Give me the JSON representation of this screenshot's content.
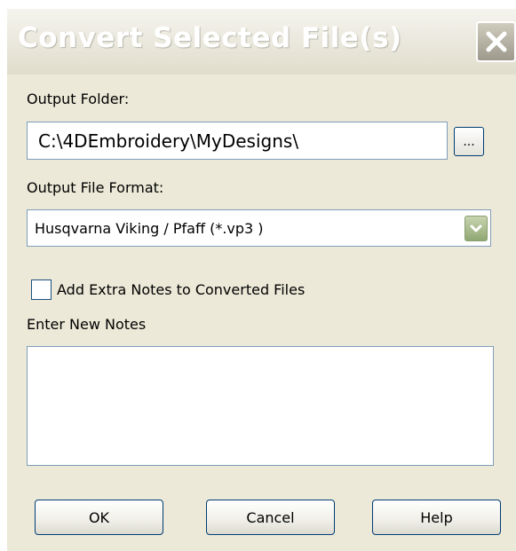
{
  "window": {
    "title": "Convert Selected File(s)",
    "close_icon": "close-icon"
  },
  "output_folder": {
    "label": "Output Folder:",
    "value": "C:\\4DEmbroidery\\MyDesigns\\",
    "browse_label": "..."
  },
  "output_format": {
    "label": "Output File Format:",
    "selected": "Husqvarna Viking / Pfaff (*.vp3 )",
    "dropdown_icon": "chevron-down-icon"
  },
  "notes": {
    "checkbox_label": "Add Extra Notes to Converted Files",
    "checkbox_checked": false,
    "enter_label": "Enter New Notes",
    "text": ""
  },
  "buttons": {
    "ok": "OK",
    "cancel": "Cancel",
    "help": "Help"
  },
  "colors": {
    "dialog_bg": "#ece9d8",
    "field_border": "#7f9db9",
    "button_border": "#003c74",
    "dropdown_accent": "#8fa772"
  }
}
